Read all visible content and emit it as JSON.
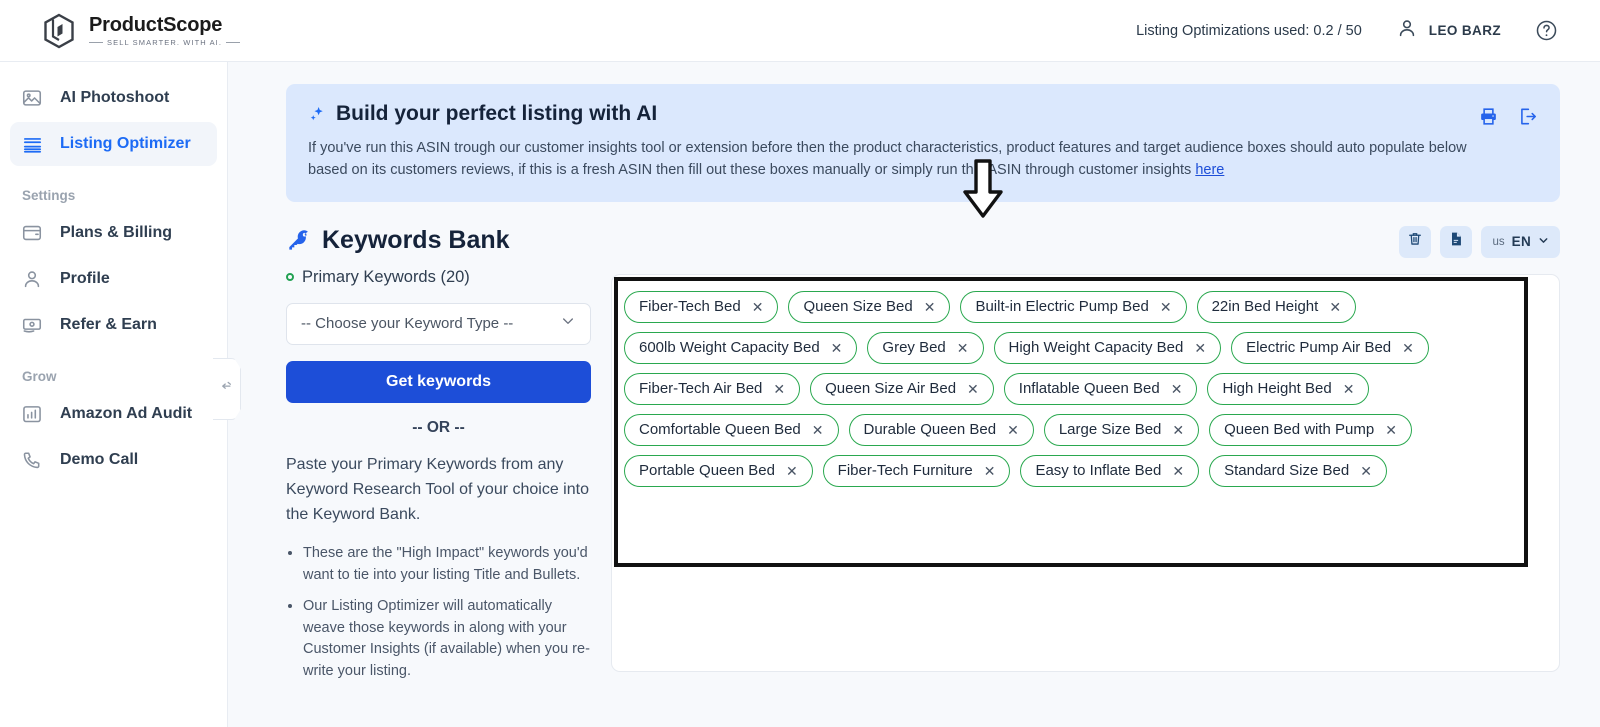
{
  "brand": {
    "name": "ProductScope",
    "tagline": "SELL SMARTER. WITH AI.",
    "logo_icon": "cube-logo-icon"
  },
  "topbar": {
    "usage_text": "Listing Optimizations used: 0.2 / 50",
    "user_name": "LEO BARZ",
    "user_icon": "user-avatar-icon",
    "help_icon": "question-circle-icon"
  },
  "sidebar": {
    "items": [
      {
        "label": "AI Photoshoot",
        "icon": "image-icon",
        "active": false
      },
      {
        "label": "Listing Optimizer",
        "icon": "lines-list-icon",
        "active": true
      }
    ],
    "sections": [
      {
        "title": "Settings",
        "items": [
          {
            "label": "Plans & Billing",
            "icon": "wallet-icon"
          },
          {
            "label": "Profile",
            "icon": "person-icon"
          },
          {
            "label": "Refer & Earn",
            "icon": "money-bill-icon"
          }
        ]
      },
      {
        "title": "Grow",
        "items": [
          {
            "label": "Amazon Ad Audit",
            "icon": "bar-chart-icon"
          },
          {
            "label": "Demo Call",
            "icon": "phone-icon"
          }
        ]
      }
    ],
    "collapse_icon": "collapse-arrows-icon"
  },
  "banner": {
    "title": "Build your perfect listing with AI",
    "sparkle_icon": "sparkle-icon",
    "body_before_link": "If you've run this ASIN trough our customer insights tool or extension before then the product characteristics, product features and target audience boxes should auto populate below based on its customers reviews, if this is a fresh ASIN then fill out these boxes manually or simply run this ASIN through customer insights ",
    "body_link": "here",
    "print_icon": "printer-icon",
    "export_icon": "export-arrow-icon"
  },
  "keywords_bank": {
    "title": "Keywords Bank",
    "title_icon": "key-icon",
    "primary_label": "Primary Keywords (20)",
    "select_value": "-- Choose your Keyword Type --",
    "select_icon": "chevron-down-icon",
    "get_button": "Get keywords",
    "or_text": "-- OR --",
    "paste_text": "Paste your Primary Keywords from any Keyword Research Tool of your choice into the Keyword Bank.",
    "bullets": [
      "These are the \"High Impact\" keywords you'd want to tie into your listing Title and Bullets.",
      "Our Listing Optimizer will automatically weave those keywords in along with your Customer Insights (if available) when you re-write your listing."
    ]
  },
  "keyword_toolbar": {
    "delete_icon": "trash-icon",
    "document_icon": "document-icon",
    "lang_country": "us",
    "lang_code": "EN",
    "lang_chevron_icon": "chevron-down-icon"
  },
  "keyword_chips": [
    "Fiber-Tech Bed",
    "Queen Size Bed",
    "Built-in Electric Pump Bed",
    "22in Bed Height",
    "600lb Weight Capacity Bed",
    "Grey Bed",
    "High Weight Capacity Bed",
    "Electric Pump Air Bed",
    "Fiber-Tech Air Bed",
    "Queen Size Air Bed",
    "Inflatable Queen Bed",
    "High Height Bed",
    "Comfortable Queen Bed",
    "Durable Queen Bed",
    "Large Size Bed",
    "Queen Bed with Pump",
    "Portable Queen Bed",
    "Fiber-Tech Furniture",
    "Easy to Inflate Bed",
    "Standard Size Bed"
  ],
  "annotations": {
    "arrow_icon": "down-arrow-annotation",
    "highlight_box": "keyword-bank-highlight"
  },
  "colors": {
    "accent_blue": "#1d4ed8",
    "active_nav_blue": "#1d6bf5",
    "banner_bg": "#dbe8fd",
    "chip_border_green": "#2aa84f",
    "page_bg": "#f7f9fc",
    "annotation_black": "#111111"
  }
}
